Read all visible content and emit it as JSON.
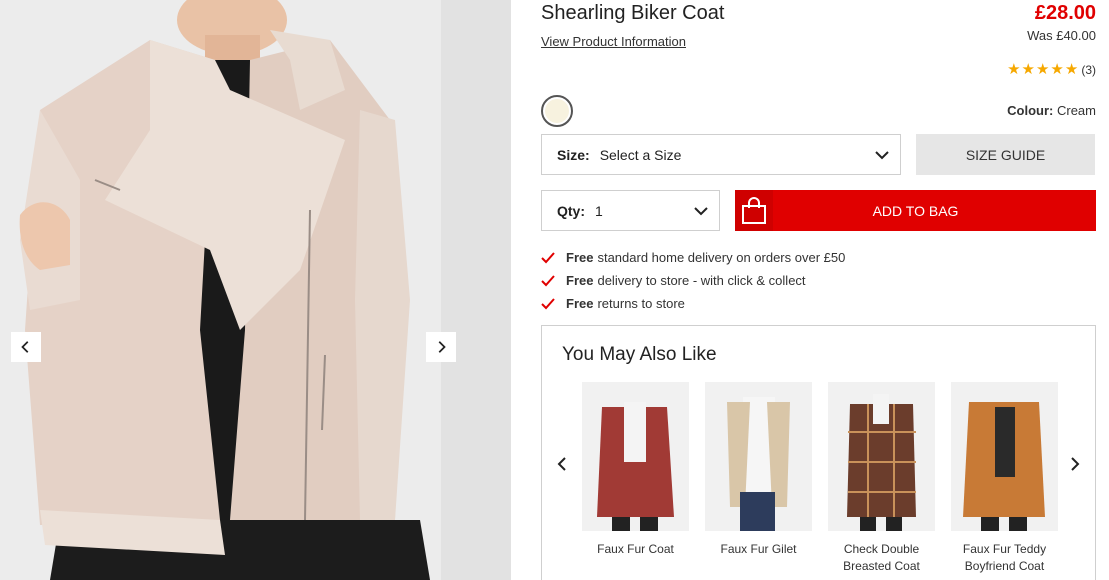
{
  "product": {
    "title": "Shearling Biker Coat",
    "view_info": "View Product Information",
    "price": "£28.00",
    "was_price": "Was £40.00",
    "rating_stars": 5,
    "review_count": "(3)"
  },
  "colour": {
    "label": "Colour:",
    "value": "Cream",
    "swatch_color": "#f7f2df"
  },
  "size": {
    "label": "Size:",
    "value": "Select a Size",
    "guide": "SIZE GUIDE"
  },
  "qty": {
    "label": "Qty:",
    "value": "1"
  },
  "cart": {
    "add_label": "ADD TO BAG"
  },
  "benefits": [
    {
      "bold": "Free",
      "text": "standard home delivery on orders over £50"
    },
    {
      "bold": "Free",
      "text": "delivery to store - with click & collect"
    },
    {
      "bold": "Free",
      "text": "returns to store"
    }
  ],
  "recommendations": {
    "title": "You May Also Like",
    "items": [
      {
        "name": "Faux Fur Coat",
        "color": "#a13a35"
      },
      {
        "name": "Faux Fur Gilet",
        "color": "#d9c6a8"
      },
      {
        "name": "Check Double Breasted Coat",
        "color": "#6b3d2c"
      },
      {
        "name": "Faux Fur Teddy Boyfriend Coat",
        "color": "#c87a36"
      }
    ]
  },
  "colors": {
    "accent_red": "#e00000",
    "star": "#f6a800"
  }
}
